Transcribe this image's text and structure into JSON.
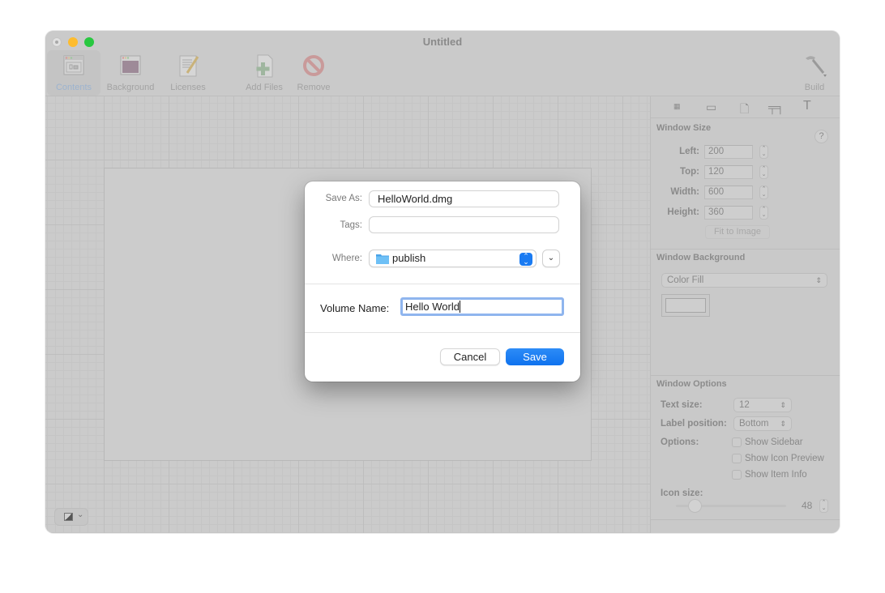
{
  "window": {
    "title": "Untitled",
    "toolbar": [
      {
        "label": "Contents",
        "icon": "contents-window-icon",
        "selected": true
      },
      {
        "label": "Background",
        "icon": "background-image-icon",
        "selected": false
      },
      {
        "label": "Licenses",
        "icon": "license-document-icon",
        "selected": false
      },
      {
        "label": "Add Files",
        "icon": "add-file-icon",
        "selected": false
      },
      {
        "label": "Remove",
        "icon": "remove-prohibited-icon",
        "selected": false
      },
      {
        "label": "Build",
        "icon": "hammer-icon",
        "selected": false
      }
    ]
  },
  "inspector": {
    "tabs": [
      "window-icon",
      "disk-icon",
      "document-icon",
      "caliper-icon",
      "text-icon"
    ],
    "window_size": {
      "title": "Window Size",
      "fields": [
        {
          "label": "Left:",
          "value": "200"
        },
        {
          "label": "Top:",
          "value": "120"
        },
        {
          "label": "Width:",
          "value": "600"
        },
        {
          "label": "Height:",
          "value": "360"
        }
      ],
      "help": "?",
      "fit_button": "Fit to Image"
    },
    "window_background": {
      "title": "Window Background",
      "fill_type": "Color Fill"
    },
    "window_options": {
      "title": "Window Options",
      "text_size_label": "Text size:",
      "text_size": "12",
      "label_position_label": "Label position:",
      "label_position": "Bottom",
      "options_label": "Options:",
      "checkboxes": [
        {
          "label": "Show Sidebar",
          "checked": false
        },
        {
          "label": "Show Icon Preview",
          "checked": false
        },
        {
          "label": "Show Item Info",
          "checked": false
        }
      ],
      "icon_size_label": "Icon size:",
      "icon_size": "48"
    }
  },
  "dialog": {
    "save_as_label": "Save As:",
    "save_as_value": "HelloWorld.dmg",
    "tags_label": "Tags:",
    "tags_value": "",
    "where_label": "Where:",
    "where_value": "publish",
    "volume_name_label": "Volume Name:",
    "volume_name_value": "Hello World",
    "cancel_label": "Cancel",
    "save_label": "Save",
    "accent_color": "#1a7bf2"
  }
}
